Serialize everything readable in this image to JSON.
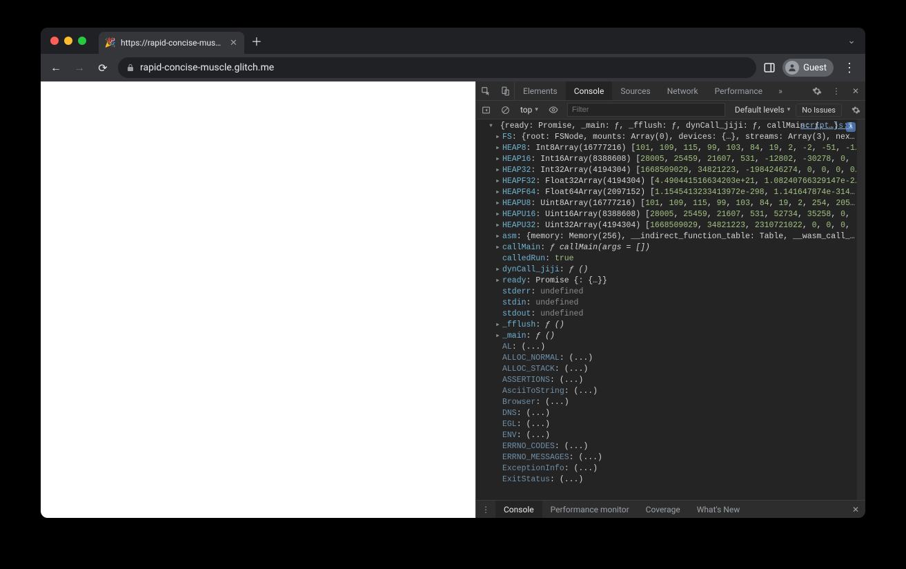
{
  "tab": {
    "title": "https://rapid-concise-muscle.g",
    "favicon": "🎉"
  },
  "url": "rapid-concise-muscle.glitch.me",
  "guest_label": "Guest",
  "devtools": {
    "tabs": [
      "Elements",
      "Console",
      "Sources",
      "Network",
      "Performance"
    ],
    "active_tab": "Console",
    "context": "top",
    "filter_placeholder": "Filter",
    "levels_label": "Default levels",
    "issues_label": "No Issues",
    "source_link": "script.js:5",
    "summary": "{ready: Promise, _main: ƒ, _fflush: ƒ, dynCall_jiji: ƒ, callMain: ƒ, …}",
    "props": [
      {
        "k": "FS",
        "v": "{root: FSNode, mounts: Array(0), devices: {…}, streams: Array(3), nex…",
        "type": "obj"
      },
      {
        "k": "HEAP8",
        "pre": "Int8Array(16777216)",
        "nums": [
          "101",
          "109",
          "115",
          "99",
          "103",
          "84",
          "19",
          "2",
          "-2",
          "-51",
          "-1…"
        ],
        "type": "arr"
      },
      {
        "k": "HEAP16",
        "pre": "Int16Array(8388608)",
        "nums": [
          "28005",
          "25459",
          "21607",
          "531",
          "-12802",
          "-30278",
          "0",
          ""
        ],
        "type": "arr"
      },
      {
        "k": "HEAP32",
        "pre": "Int32Array(4194304)",
        "nums": [
          "1668509029",
          "34821223",
          "-1984246274",
          "0",
          "0",
          "0",
          "0…"
        ],
        "type": "arr"
      },
      {
        "k": "HEAPF32",
        "pre": "Float32Array(4194304)",
        "nums": [
          "4.490441516634203e+21",
          "1.08240766329147e-2…"
        ],
        "type": "arr"
      },
      {
        "k": "HEAPF64",
        "pre": "Float64Array(2097152)",
        "nums": [
          "1.1545413233413972e-298",
          "1.141647874e-314…"
        ],
        "type": "arr"
      },
      {
        "k": "HEAPU8",
        "pre": "Uint8Array(16777216)",
        "nums": [
          "101",
          "109",
          "115",
          "99",
          "103",
          "84",
          "19",
          "2",
          "254",
          "205…"
        ],
        "type": "arr"
      },
      {
        "k": "HEAPU16",
        "pre": "Uint16Array(8388608)",
        "nums": [
          "28005",
          "25459",
          "21607",
          "531",
          "52734",
          "35258",
          "0",
          ""
        ],
        "type": "arr"
      },
      {
        "k": "HEAPU32",
        "pre": "Uint32Array(4194304)",
        "nums": [
          "1668509029",
          "34821223",
          "2310721022",
          "0",
          "0",
          "0",
          ""
        ],
        "type": "arr"
      },
      {
        "k": "asm",
        "v": "{memory: Memory(256), __indirect_function_table: Table, __wasm_call_…",
        "type": "obj"
      },
      {
        "k": "callMain",
        "v": "ƒ callMain(args = [])",
        "type": "fn"
      },
      {
        "k": "calledRun",
        "v": "true",
        "type": "bool",
        "noTri": true
      },
      {
        "k": "dynCall_jiji",
        "v": "ƒ ()",
        "type": "fn"
      },
      {
        "k": "ready",
        "v": "Promise {<fulfilled>: {…}}",
        "type": "obj"
      },
      {
        "k": "stderr",
        "v": "undefined",
        "type": "undef",
        "noTri": true
      },
      {
        "k": "stdin",
        "v": "undefined",
        "type": "undef",
        "noTri": true
      },
      {
        "k": "stdout",
        "v": "undefined",
        "type": "undef",
        "noTri": true
      },
      {
        "k": "_fflush",
        "v": "ƒ ()",
        "type": "fn"
      },
      {
        "k": "_main",
        "v": "ƒ ()",
        "type": "fn"
      },
      {
        "k": "AL",
        "v": "(...)",
        "type": "getter",
        "noTri": true
      },
      {
        "k": "ALLOC_NORMAL",
        "v": "(...)",
        "type": "getter",
        "noTri": true
      },
      {
        "k": "ALLOC_STACK",
        "v": "(...)",
        "type": "getter",
        "noTri": true
      },
      {
        "k": "ASSERTIONS",
        "v": "(...)",
        "type": "getter",
        "noTri": true
      },
      {
        "k": "AsciiToString",
        "v": "(...)",
        "type": "getter",
        "noTri": true
      },
      {
        "k": "Browser",
        "v": "(...)",
        "type": "getter",
        "noTri": true
      },
      {
        "k": "DNS",
        "v": "(...)",
        "type": "getter",
        "noTri": true
      },
      {
        "k": "EGL",
        "v": "(...)",
        "type": "getter",
        "noTri": true
      },
      {
        "k": "ENV",
        "v": "(...)",
        "type": "getter",
        "noTri": true
      },
      {
        "k": "ERRNO_CODES",
        "v": "(...)",
        "type": "getter",
        "noTri": true
      },
      {
        "k": "ERRNO_MESSAGES",
        "v": "(...)",
        "type": "getter",
        "noTri": true
      },
      {
        "k": "ExceptionInfo",
        "v": "(...)",
        "type": "getter",
        "noTri": true
      },
      {
        "k": "ExitStatus",
        "v": "(...)",
        "type": "getter",
        "noTri": true
      }
    ],
    "drawer_tabs": [
      "Console",
      "Performance monitor",
      "Coverage",
      "What's New"
    ],
    "drawer_active": "Console"
  }
}
